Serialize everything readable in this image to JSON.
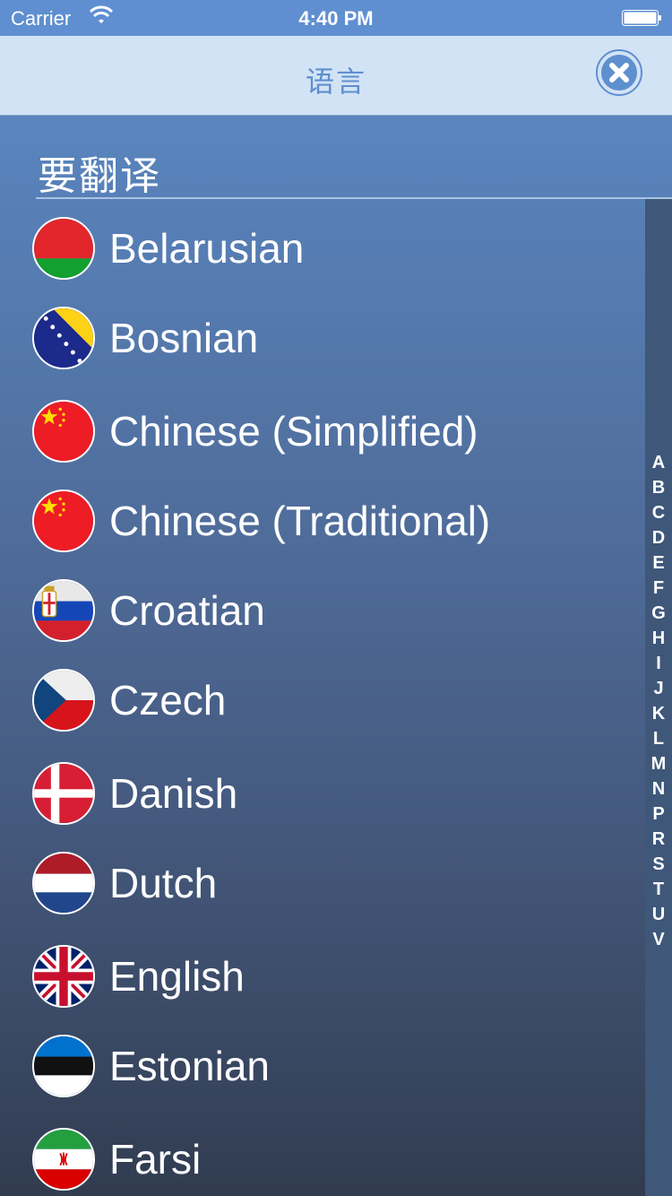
{
  "status_bar": {
    "carrier": "Carrier",
    "time": "4:40 PM"
  },
  "nav": {
    "title": "语言",
    "close_icon": "close-circle-icon"
  },
  "section": {
    "header": "要翻译"
  },
  "languages": [
    {
      "name": "Belarusian",
      "flag_icon": "belarus-flag-icon"
    },
    {
      "name": "Bosnian",
      "flag_icon": "bosnia-flag-icon"
    },
    {
      "name": "Chinese (Simplified)",
      "flag_icon": "china-flag-icon"
    },
    {
      "name": "Chinese (Traditional)",
      "flag_icon": "china-flag-icon"
    },
    {
      "name": "Croatian",
      "flag_icon": "serbia-flag-icon"
    },
    {
      "name": "Czech",
      "flag_icon": "czech-flag-icon"
    },
    {
      "name": "Danish",
      "flag_icon": "denmark-flag-icon"
    },
    {
      "name": "Dutch",
      "flag_icon": "netherlands-flag-icon"
    },
    {
      "name": "English",
      "flag_icon": "uk-flag-icon"
    },
    {
      "name": "Estonian",
      "flag_icon": "estonia-flag-icon"
    },
    {
      "name": "Farsi",
      "flag_icon": "iran-flag-icon"
    }
  ],
  "index_letters": [
    "A",
    "B",
    "C",
    "D",
    "E",
    "F",
    "G",
    "H",
    "I",
    "J",
    "K",
    "L",
    "M",
    "N",
    "P",
    "R",
    "S",
    "T",
    "U",
    "V"
  ],
  "colors": {
    "accent": "#5e8fcf",
    "nav_bg": "#d3e3f6",
    "status_bg": "#5f8fd0"
  }
}
